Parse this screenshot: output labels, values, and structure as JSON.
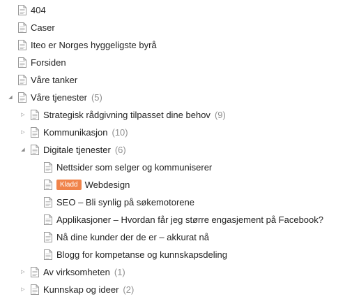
{
  "tree": {
    "items": [
      {
        "title": "404"
      },
      {
        "title": "Caser"
      },
      {
        "title": "Iteo er Norges hyggeligste byrå"
      },
      {
        "title": "Forsiden"
      },
      {
        "title": "Våre tanker"
      },
      {
        "title": "Våre tjenester",
        "count": "(5)",
        "expanded": true
      },
      {
        "title": "Strategisk rådgivning tilpasset dine behov",
        "count": "(9)",
        "expanded": false
      },
      {
        "title": "Kommunikasjon",
        "count": "(10)",
        "expanded": false
      },
      {
        "title": "Digitale tjenester",
        "count": "(6)",
        "expanded": true
      },
      {
        "title": "Nettsider som selger og kommuniserer"
      },
      {
        "title": "Webdesign",
        "badge": "Kladd"
      },
      {
        "title": "SEO – Bli synlig på søkemotorene"
      },
      {
        "title": "Applikasjoner – Hvordan får jeg større engasjement på Facebook?"
      },
      {
        "title": "Nå dine kunder der de er – akkurat nå"
      },
      {
        "title": "Blogg for kompetanse og kunnskapsdeling"
      },
      {
        "title": "Av virksomheten",
        "count": "(1)",
        "expanded": false
      },
      {
        "title": "Kunnskap og ideer",
        "count": "(2)",
        "expanded": false
      }
    ]
  },
  "icons": {
    "page": "page-icon",
    "expanded": "triangle-down-icon",
    "collapsed": "triangle-right-icon"
  },
  "colors": {
    "badge": "#f0834a",
    "count": "#8f8f8f",
    "text": "#222222"
  }
}
